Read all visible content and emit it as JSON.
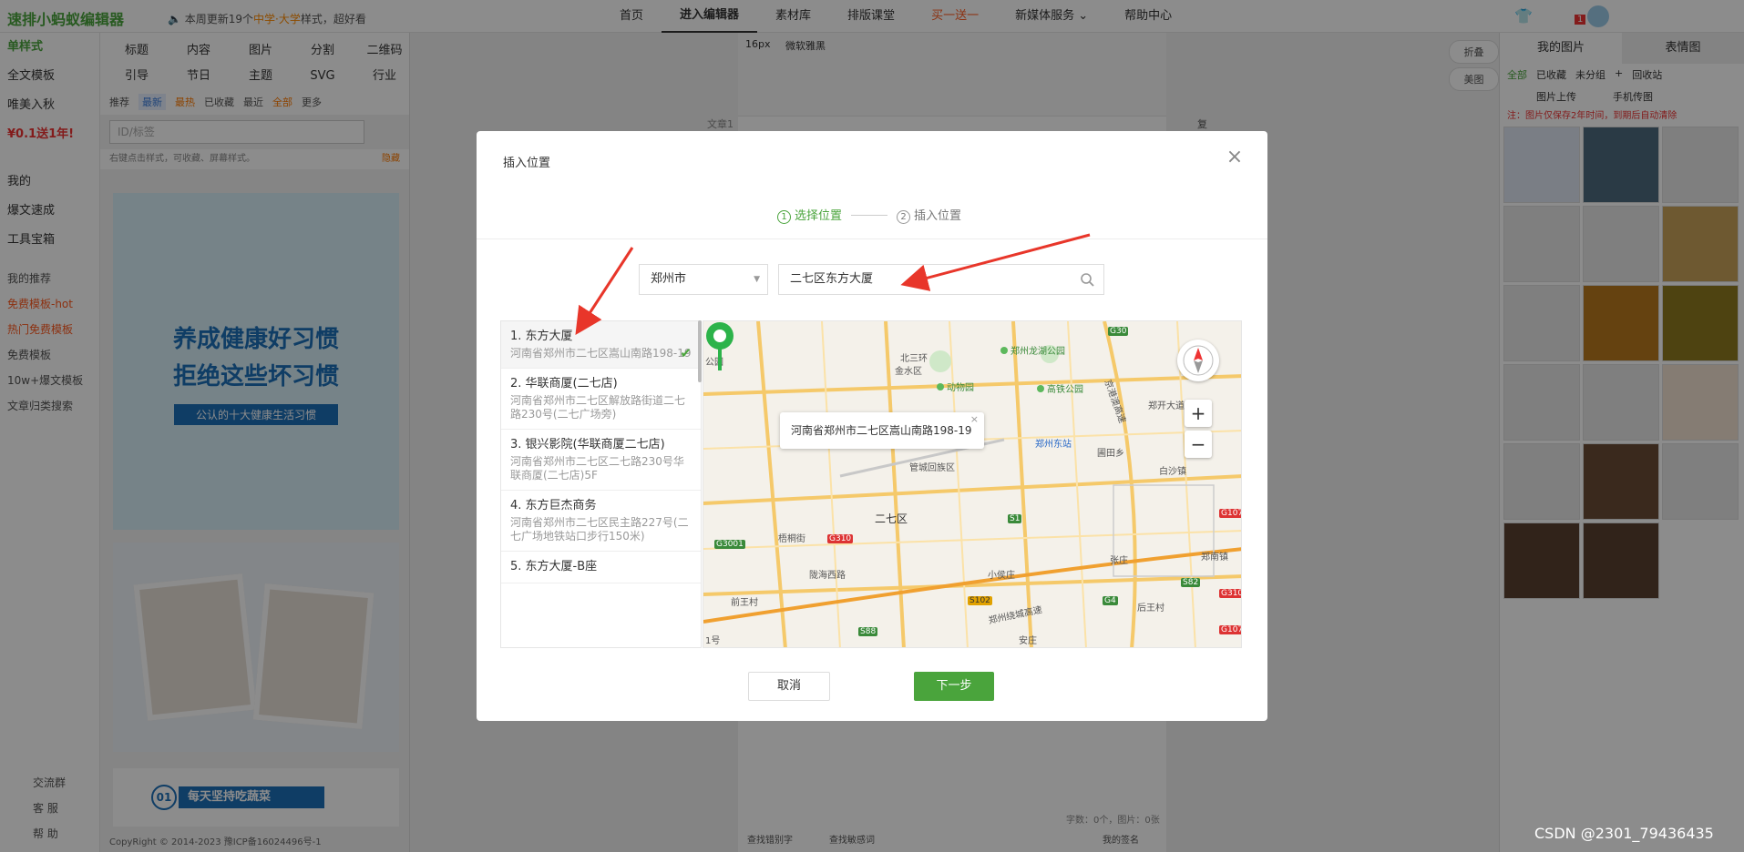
{
  "topbar": {
    "logo": "速排小蚂蚁编辑器",
    "notice_prefix": "本周更新19个",
    "notice_highlight": "中学·大学",
    "notice_suffix": "样式，超好看",
    "nav": [
      "首页",
      "进入编辑器",
      "素材库",
      "排版课堂",
      "买一送一",
      "新媒体服务 ⌄",
      "帮助中心"
    ],
    "badge": "1"
  },
  "left_menu": {
    "items": [
      "单样式",
      "全文模板",
      "唯美入秋",
      "¥0.1送1年!",
      "我的",
      "爆文速成",
      "工具宝箱",
      "我的推荐"
    ],
    "sub": [
      "免费模板-hot",
      "热门免费模板",
      "免费模板",
      "10w+爆文模板",
      "文章归类搜索"
    ],
    "bottom": [
      "交流群",
      "客 服",
      "帮 助"
    ]
  },
  "style_panel": {
    "tabs": [
      "标题",
      "内容",
      "图片",
      "分割",
      "二维码",
      "引导",
      "节日",
      "主题",
      "SVG",
      "行业"
    ],
    "filters": [
      "推荐",
      "最新",
      "最热",
      "已收藏",
      "最近",
      "全部",
      "更多"
    ],
    "search_placeholder": "ID/标签",
    "tip": "右键点击样式，可收藏、屏幕样式。",
    "tip_link": "隐藏",
    "card1_title1": "养成健康好习惯",
    "card1_title2": "拒绝这些坏习惯",
    "card1_sub": "公认的十大健康生活习惯",
    "card3_num": "01",
    "card3_text": "每天坚持吃蔬菜"
  },
  "editor": {
    "font_size": "16px",
    "font_name": "微软雅黑",
    "doc_tab": "文章1",
    "copy": "复制",
    "word_count": "字数：0个，图片：0张",
    "find1": "查找错别字",
    "find2": "查找敏感词",
    "signature": "我的签名"
  },
  "right_panel": {
    "tab_my_images": "我的图片",
    "tab_emoji": "表情图",
    "sub": [
      "全部",
      "已收藏",
      "未分组",
      "+",
      "回收站"
    ],
    "upload": "图片上传",
    "phone": "手机传图",
    "note": "注：图片仅保存2年时间，到期后自动清除",
    "side": [
      "折叠",
      "美图"
    ]
  },
  "modal": {
    "title": "插入位置",
    "step1_num": "1",
    "step1": "选择位置",
    "step2_num": "2",
    "step2": "插入位置",
    "city": "郑州市",
    "search_value": "二七区东方大厦",
    "results": [
      {
        "name": "1. 东方大厦",
        "addr": "河南省郑州市二七区嵩山南路198-19"
      },
      {
        "name": "2. 华联商厦(二七店)",
        "addr": "河南省郑州市二七区解放路街道二七路230号(二七广场旁)"
      },
      {
        "name": "3. 银兴影院(华联商厦二七店)",
        "addr": "河南省郑州市二七区二七路230号华联商厦(二七店)5F"
      },
      {
        "name": "4. 东方巨杰商务",
        "addr": "河南省郑州市二七区民主路227号(二七广场地铁站口步行150米)"
      },
      {
        "name": "5. 东方大厦-B座",
        "addr": ""
      }
    ],
    "popup": "河南省郑州市二七区嵩山南路198-19",
    "popup_close": "×",
    "zoom_in": "+",
    "zoom_out": "−",
    "cancel": "取消",
    "next": "下一步",
    "close": "×"
  },
  "map_labels": {
    "beisanhuan": "北三环",
    "jinshui": "金水区",
    "dongwuyuan": "动物园",
    "longhu": "郑州龙湖公园",
    "gaotie": "高铁公园",
    "zhengdong": "郑州东站",
    "guancheng": "管城回族区",
    "erqi": "二七区",
    "wutong": "梧桐街",
    "jingang": "京港澳高速",
    "zhengkai": "郑开大道",
    "putian": "圃田乡",
    "baisha": "白沙镇",
    "zhangzhuang": "张庄",
    "zhengwei": "郑南镇",
    "xiaoliu": "小侯庄",
    "anshang": "安庄",
    "zhengxin": "郑州绕城高速",
    "houzhuang": "后王村",
    "longhai": "陇海西路",
    "qianzhai": "前王村",
    "gongyuan": "公园",
    "one": "1号",
    "g30": "G30",
    "g107": "G107",
    "g310": "G310",
    "g3001": "G3001",
    "s1": "S1",
    "s82": "S82",
    "s102": "S102",
    "g4": "G4",
    "s88": "S88",
    "g310b": "G310",
    "g107b": "G107"
  },
  "footer": {
    "copyright": "CopyRight © 2014-2023 豫ICP备16024496号-1"
  },
  "watermark": "CSDN @2301_79436435",
  "colors": {
    "accent_green": "#4aa43c",
    "arrow_red": "#e8362a",
    "overlay": "rgba(0,0,0,0.45)"
  }
}
